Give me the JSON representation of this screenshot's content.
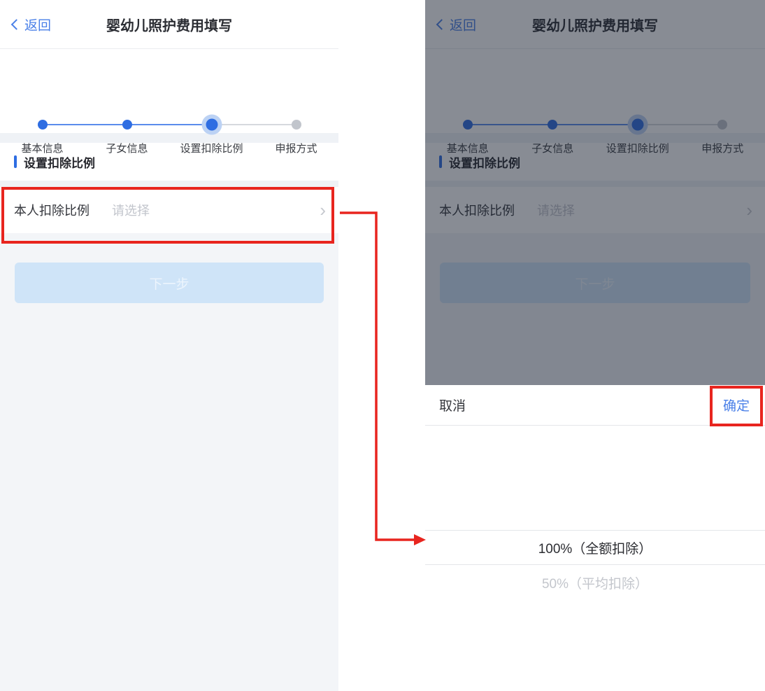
{
  "colors": {
    "accent_blue": "#4a80e8",
    "stepper_blue": "#2e6de2",
    "stepper_halo": "#bcd2f4",
    "inactive_gray": "#c1c5cc",
    "highlight_red": "#e8251f",
    "disabled_button_bg": "#cfe4f8",
    "disabled_button_text": "#edf5fd",
    "dim_overlay": "rgba(27,34,50,0.52)"
  },
  "screen": {
    "nav": {
      "back_label": "返回",
      "title": "婴幼儿照护费用填写"
    },
    "stepper": {
      "steps": [
        {
          "label": "基本信息",
          "state": "done"
        },
        {
          "label": "子女信息",
          "state": "done"
        },
        {
          "label": "设置扣除比例",
          "state": "current"
        },
        {
          "label": "申报方式",
          "state": "upcoming"
        }
      ]
    },
    "section_title": "设置扣除比例",
    "field": {
      "label": "本人扣除比例",
      "placeholder": "请选择",
      "chevron": "›"
    },
    "next_button": {
      "label": "下一步",
      "enabled": false
    }
  },
  "picker": {
    "cancel_label": "取消",
    "confirm_label": "确定",
    "options": [
      {
        "label": "100%（全额扣除）",
        "selected": true
      },
      {
        "label": "50%（平均扣除）",
        "selected": false
      }
    ]
  }
}
